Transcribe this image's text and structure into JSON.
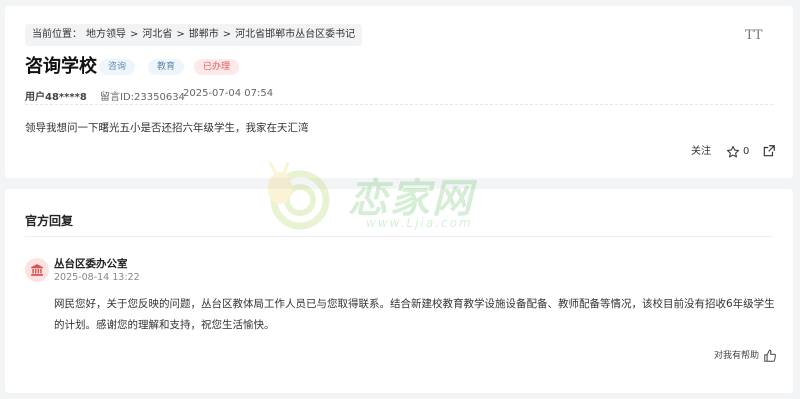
{
  "breadcrumb": {
    "prefix": "当前位置：",
    "items": [
      "地方领导",
      "河北省",
      "邯郸市",
      "河北省邯郸市丛台区委书记"
    ],
    "separator": ">"
  },
  "font_tool_label": "TT",
  "question": {
    "title": "咨询学校",
    "tags": [
      "咨询",
      "教育",
      "已办理"
    ],
    "user": "用户48****8",
    "message_id": "留言ID:23350634",
    "time": "2025-07-04 07:54",
    "content": "领导我想问一下曙光五小是否还招六年级学生，我家在天汇湾"
  },
  "actions": {
    "follow_label": "关注",
    "star_count": "0"
  },
  "official": {
    "section_title": "官方回复",
    "org_name": "丛台区委办公室",
    "time": "2025-08-14 13:22",
    "reply_text": "网民您好，关于您反映的问题，丛台区教体局工作人员已与您取得联系。结合新建校教育教学设施设备配备、教师配备等情况，该校目前没有招收6年级学生的计划。感谢您的理解和支持，祝您生活愉快。",
    "helpful_label": "对我有帮助"
  },
  "watermark": {
    "text": "恋家网",
    "url": "www.Ljia.com"
  },
  "colors": {
    "tag_blue_bg": "#eef5fb",
    "tag_blue_text": "#5d8bb3",
    "tag_red_bg": "#fde9e9",
    "tag_red_text": "#e05b5b",
    "org_icon": "#d9534f",
    "watermark": "#49b749"
  },
  "icons": [
    "font-size-icon",
    "star-icon",
    "share-icon",
    "government-building-icon",
    "thumbs-up-icon"
  ]
}
